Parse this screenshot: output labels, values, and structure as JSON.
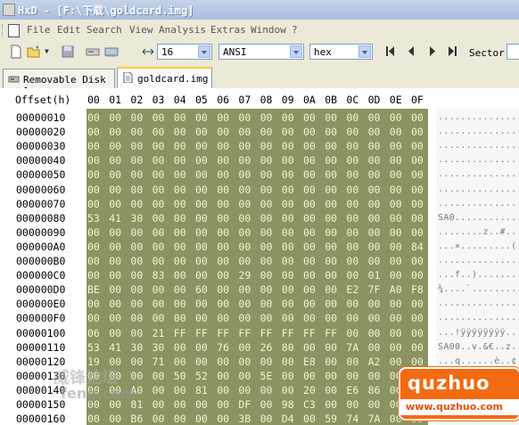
{
  "window": {
    "title": "HxD - [F:\\下载\\goldcard.img]"
  },
  "menu": [
    "File",
    "Edit",
    "Search",
    "View",
    "Analysis",
    "Extras",
    "Window",
    "?"
  ],
  "toolbar": {
    "bytes_per_row": "16",
    "charset": "ANSI",
    "offset_base": "hex",
    "sector_label": "Sector"
  },
  "tabs": [
    {
      "label": "Removable Disk 1",
      "active": false
    },
    {
      "label": "goldcard.img",
      "active": true
    }
  ],
  "editor": {
    "offset_header": "Offset(h)",
    "column_headers": [
      "00",
      "01",
      "02",
      "03",
      "04",
      "05",
      "06",
      "07",
      "08",
      "09",
      "0A",
      "0B",
      "0C",
      "0D",
      "0E",
      "0F"
    ],
    "rows": [
      {
        "offset": "00000010",
        "bytes": [
          "00",
          "00",
          "00",
          "00",
          "00",
          "00",
          "00",
          "00",
          "00",
          "00",
          "00",
          "00",
          "00",
          "00",
          "00",
          "00"
        ],
        "ascii": "................"
      },
      {
        "offset": "00000020",
        "bytes": [
          "00",
          "00",
          "00",
          "00",
          "00",
          "00",
          "00",
          "00",
          "00",
          "00",
          "00",
          "00",
          "00",
          "00",
          "00",
          "00"
        ],
        "ascii": "................"
      },
      {
        "offset": "00000030",
        "bytes": [
          "00",
          "00",
          "00",
          "00",
          "00",
          "00",
          "00",
          "00",
          "00",
          "00",
          "00",
          "00",
          "00",
          "00",
          "00",
          "00"
        ],
        "ascii": "................"
      },
      {
        "offset": "00000040",
        "bytes": [
          "00",
          "00",
          "00",
          "00",
          "00",
          "00",
          "00",
          "00",
          "00",
          "00",
          "00",
          "00",
          "00",
          "00",
          "00",
          "00"
        ],
        "ascii": "................"
      },
      {
        "offset": "00000050",
        "bytes": [
          "00",
          "00",
          "00",
          "00",
          "00",
          "00",
          "00",
          "00",
          "00",
          "00",
          "00",
          "00",
          "00",
          "00",
          "00",
          "00"
        ],
        "ascii": "................"
      },
      {
        "offset": "00000060",
        "bytes": [
          "00",
          "00",
          "00",
          "00",
          "00",
          "00",
          "00",
          "00",
          "00",
          "00",
          "00",
          "00",
          "00",
          "00",
          "00",
          "00"
        ],
        "ascii": "................"
      },
      {
        "offset": "00000070",
        "bytes": [
          "00",
          "00",
          "00",
          "00",
          "00",
          "00",
          "00",
          "00",
          "00",
          "00",
          "00",
          "00",
          "00",
          "00",
          "00",
          "00"
        ],
        "ascii": "................"
      },
      {
        "offset": "00000080",
        "bytes": [
          "53",
          "41",
          "30",
          "00",
          "00",
          "00",
          "00",
          "00",
          "00",
          "00",
          "00",
          "00",
          "00",
          "00",
          "00",
          "00"
        ],
        "ascii": "SA0............."
      },
      {
        "offset": "00000090",
        "bytes": [
          "00",
          "00",
          "00",
          "00",
          "00",
          "00",
          "00",
          "00",
          "00",
          "00",
          "00",
          "00",
          "00",
          "00",
          "00",
          "00"
        ],
        "ascii": "........z..#...."
      },
      {
        "offset": "000000A0",
        "bytes": [
          "00",
          "00",
          "00",
          "00",
          "00",
          "00",
          "00",
          "00",
          "00",
          "00",
          "00",
          "00",
          "00",
          "00",
          "00",
          "84"
        ],
        "ascii": "...×.........(.."
      },
      {
        "offset": "000000B0",
        "bytes": [
          "00",
          "00",
          "00",
          "00",
          "00",
          "00",
          "00",
          "00",
          "00",
          "00",
          "00",
          "00",
          "00",
          "00",
          "00",
          "00"
        ],
        "ascii": "................"
      },
      {
        "offset": "000000C0",
        "bytes": [
          "00",
          "00",
          "00",
          "83",
          "00",
          "00",
          "00",
          "29",
          "00",
          "00",
          "00",
          "00",
          "00",
          "01",
          "00",
          "00"
        ],
        "ascii": "...f..)........."
      },
      {
        "offset": "000000D0",
        "bytes": [
          "BE",
          "00",
          "00",
          "00",
          "00",
          "60",
          "00",
          "00",
          "00",
          "00",
          "00",
          "00",
          "E2",
          "7F",
          "A0",
          "F8"
        ],
        "ascii": "¾....`.........."
      },
      {
        "offset": "000000E0",
        "bytes": [
          "00",
          "00",
          "00",
          "00",
          "00",
          "00",
          "00",
          "00",
          "00",
          "00",
          "00",
          "00",
          "00",
          "00",
          "00",
          "00"
        ],
        "ascii": "................"
      },
      {
        "offset": "000000F0",
        "bytes": [
          "00",
          "00",
          "00",
          "00",
          "00",
          "00",
          "00",
          "00",
          "00",
          "00",
          "00",
          "00",
          "00",
          "00",
          "00",
          "00"
        ],
        "ascii": "................"
      },
      {
        "offset": "00000100",
        "bytes": [
          "06",
          "00",
          "00",
          "21",
          "FF",
          "FF",
          "FF",
          "FF",
          "FF",
          "FF",
          "FF",
          "FF",
          "00",
          "00",
          "00",
          "00"
        ],
        "ascii": "...!ÿÿÿÿÿÿÿÿ...."
      },
      {
        "offset": "00000110",
        "bytes": [
          "53",
          "41",
          "30",
          "30",
          "00",
          "00",
          "76",
          "00",
          "26",
          "80",
          "00",
          "00",
          "7A",
          "00",
          "00",
          "00"
        ],
        "ascii": "SA00..v.&€..z..."
      },
      {
        "offset": "00000120",
        "bytes": [
          "19",
          "00",
          "00",
          "71",
          "00",
          "00",
          "00",
          "00",
          "00",
          "00",
          "E8",
          "00",
          "00",
          "A2",
          "00",
          "00"
        ],
        "ascii": "...q......è..¢.."
      },
      {
        "offset": "00000130",
        "bytes": [
          "00",
          "00",
          "00",
          "00",
          "50",
          "52",
          "00",
          "00",
          "5E",
          "00",
          "00",
          "00",
          "00",
          "00",
          "00",
          "00"
        ],
        "ascii": "....PR..^......."
      },
      {
        "offset": "00000140",
        "bytes": [
          "00",
          "00",
          "A0",
          "00",
          "00",
          "81",
          "00",
          "00",
          "00",
          "00",
          "20",
          "00",
          "E6",
          "86",
          "00",
          "00"
        ],
        "ascii": "..... ..æ†......"
      },
      {
        "offset": "00000150",
        "bytes": [
          "00",
          "00",
          "81",
          "00",
          "00",
          "00",
          "00",
          "DF",
          "00",
          "98",
          "C3",
          "00",
          "00",
          "00",
          "00",
          "00"
        ],
        "ascii": "...ß.˜Ã........."
      },
      {
        "offset": "00000160",
        "bytes": [
          "00",
          "00",
          "B6",
          "00",
          "00",
          "00",
          "00",
          "3B",
          "00",
          "D4",
          "00",
          "59",
          "74",
          "7A",
          "00",
          "00"
        ],
        "ascii": "..¶...;.Ô.Ytz..."
      }
    ]
  },
  "watermarks": {
    "left_top": "威锋论坛",
    "left_bottom": "feng.com",
    "right_logo": "quzhuo",
    "right_url": "www.quzhuo.com"
  },
  "colors": {
    "hex_background": "#8b9460",
    "hex_text": "#f3f1da",
    "window_bg": "#ece9d8",
    "logo": "#f46a10"
  }
}
